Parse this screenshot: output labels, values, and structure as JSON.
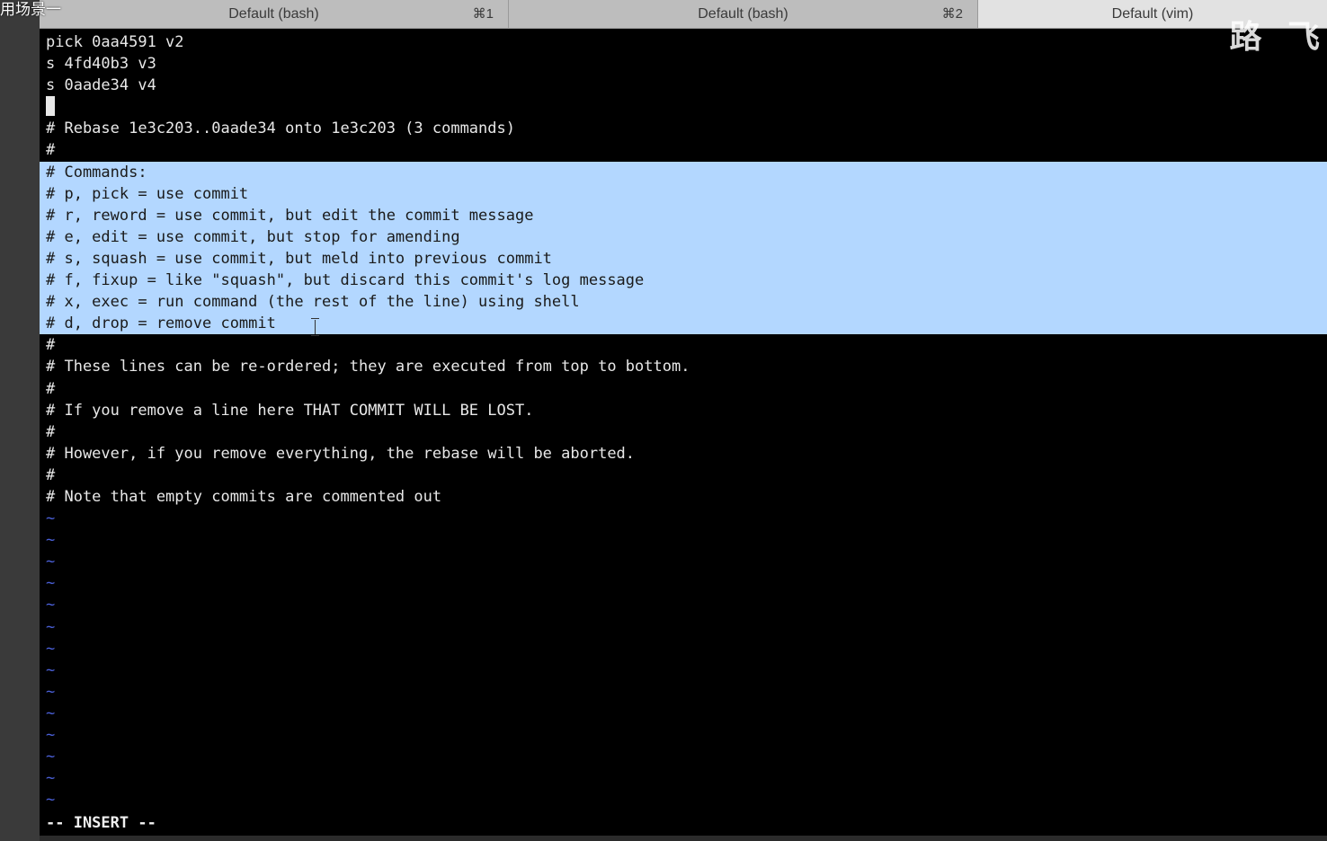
{
  "overlay_text": "用场景一",
  "watermark": "路 飞",
  "tabs": [
    {
      "label": "Default (bash)",
      "shortcut": "⌘1"
    },
    {
      "label": "Default (bash)",
      "shortcut": "⌘2"
    },
    {
      "label": "Default (vim)",
      "shortcut": ""
    }
  ],
  "editor": {
    "lines": [
      {
        "text": "pick 0aa4591 v2",
        "selected": false
      },
      {
        "text": "s 4fd40b3 v3",
        "selected": false
      },
      {
        "text": "s 0aade34 v4",
        "selected": false
      },
      {
        "text": "",
        "selected": false,
        "cursor": true
      },
      {
        "text": "# Rebase 1e3c203..0aade34 onto 1e3c203 (3 commands)",
        "selected": false
      },
      {
        "text": "#",
        "selected": false
      },
      {
        "text": "# Commands:",
        "selected": true
      },
      {
        "text": "# p, pick = use commit",
        "selected": true
      },
      {
        "text": "# r, reword = use commit, but edit the commit message",
        "selected": true
      },
      {
        "text": "# e, edit = use commit, but stop for amending",
        "selected": true
      },
      {
        "text": "# s, squash = use commit, but meld into previous commit",
        "selected": true
      },
      {
        "text": "# f, fixup = like \"squash\", but discard this commit's log message",
        "selected": true
      },
      {
        "text": "# x, exec = run command (the rest of the line) using shell",
        "selected": true
      },
      {
        "text": "# d, drop = remove commit",
        "selected": true,
        "ibeam": true
      },
      {
        "text": "#",
        "selected": false
      },
      {
        "text": "# These lines can be re-ordered; they are executed from top to bottom.",
        "selected": false
      },
      {
        "text": "#",
        "selected": false
      },
      {
        "text": "# If you remove a line here THAT COMMIT WILL BE LOST.",
        "selected": false
      },
      {
        "text": "#",
        "selected": false
      },
      {
        "text": "# However, if you remove everything, the rebase will be aborted.",
        "selected": false
      },
      {
        "text": "#",
        "selected": false
      },
      {
        "text": "# Note that empty commits are commented out",
        "selected": false
      }
    ],
    "tilde_glyph": "~",
    "tilde_count": 14,
    "mode_text": "-- INSERT --"
  },
  "colors": {
    "selection": "#b3d7ff",
    "tilde": "#4a5fd6",
    "background": "#000000",
    "text": "#e8e8e8"
  }
}
